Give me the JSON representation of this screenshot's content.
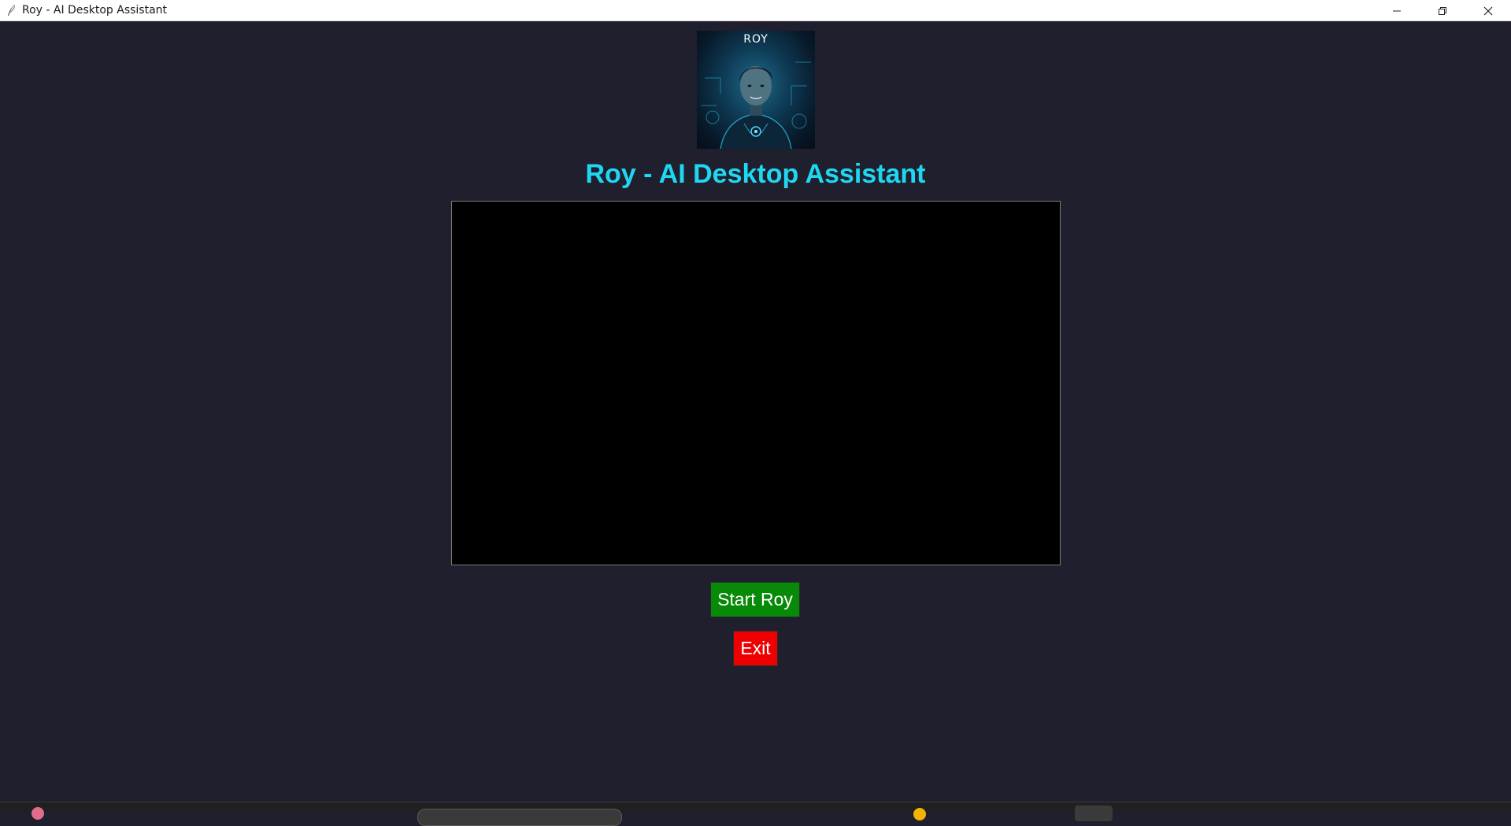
{
  "window": {
    "title": "Roy - AI Desktop Assistant",
    "controls": {
      "minimize_icon": "minimize-icon",
      "maximize_icon": "restore-icon",
      "close_icon": "close-icon"
    }
  },
  "avatar": {
    "label": "ROY",
    "icon": "avatar-portrait"
  },
  "header": {
    "title": "Roy - AI Desktop Assistant",
    "title_color": "#1fd7f0"
  },
  "output": {
    "text": ""
  },
  "buttons": {
    "start_label": "Start Roy",
    "start_color": "#078a07",
    "exit_label": "Exit",
    "exit_color": "#ee0000"
  },
  "colors": {
    "background": "#1f1f2e",
    "panel": "#000000"
  }
}
